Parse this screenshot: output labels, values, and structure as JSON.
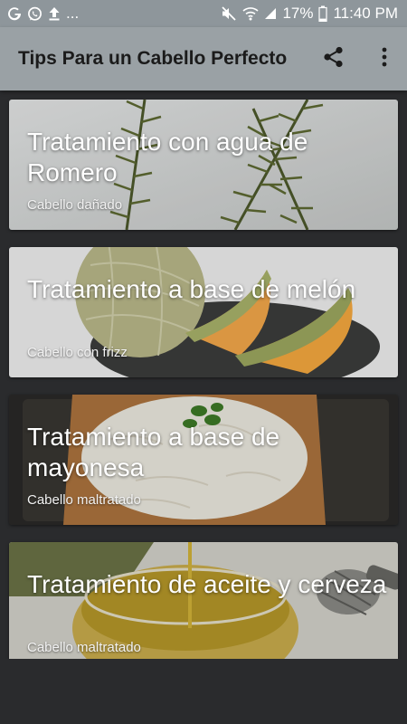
{
  "status_bar": {
    "left_icons": [
      "google-g-icon",
      "whatsapp-icon",
      "upload-icon",
      "more-notifications-icon"
    ],
    "more_text": "...",
    "right_icons": [
      "mute-icon",
      "wifi-icon",
      "signal-icon",
      "battery-icon"
    ],
    "battery": "17%",
    "time": "11:40 PM"
  },
  "app_bar": {
    "title": "Tips Para un Cabello Perfecto",
    "actions": [
      "share-icon",
      "overflow-menu-icon"
    ],
    "background": "#9aa1a5"
  },
  "cards": [
    {
      "title": "Tratamiento con agua de Romero",
      "subtitle": "Cabello dañado",
      "image": "rosemary"
    },
    {
      "title": "Tratamiento a base  de melón",
      "subtitle": " Cabello con frizz",
      "image": "melon"
    },
    {
      "title": "Tratamiento a base de mayonesa",
      "subtitle": "Cabello maltratado",
      "image": "mayonnaise"
    },
    {
      "title": "Tratamiento de aceite y cerveza",
      "subtitle": "Cabello maltratado",
      "image": "oil-and-beer"
    }
  ]
}
